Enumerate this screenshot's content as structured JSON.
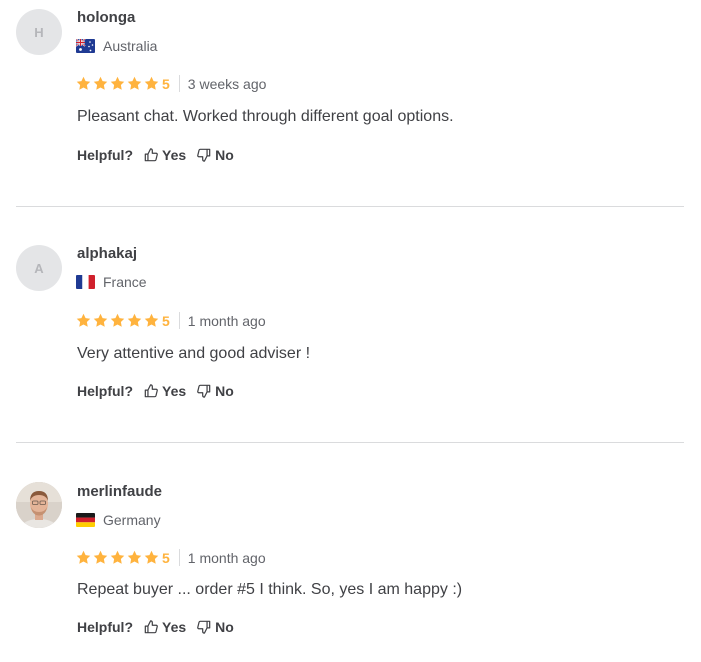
{
  "reviews": [
    {
      "avatar_initial": "H",
      "avatar_type": "initial",
      "username": "holonga",
      "country": "Australia",
      "flag_icon": "australia-flag-icon",
      "stars": 5,
      "rating": "5",
      "time": "3 weeks ago",
      "text": "Pleasant chat. Worked through different goal options.",
      "helpful_label": "Helpful?",
      "yes_label": "Yes",
      "no_label": "No"
    },
    {
      "avatar_initial": "A",
      "avatar_type": "initial",
      "username": "alphakaj",
      "country": "France",
      "flag_icon": "france-flag-icon",
      "stars": 5,
      "rating": "5",
      "time": "1 month ago",
      "text": "Very attentive and good adviser !",
      "helpful_label": "Helpful?",
      "yes_label": "Yes",
      "no_label": "No"
    },
    {
      "avatar_initial": "",
      "avatar_type": "photo",
      "username": "merlinfaude",
      "country": "Germany",
      "flag_icon": "germany-flag-icon",
      "stars": 5,
      "rating": "5",
      "time": "1 month ago",
      "text": "Repeat buyer ... order #5 I think. So, yes I am happy :)",
      "helpful_label": "Helpful?",
      "yes_label": "Yes",
      "no_label": "No"
    }
  ],
  "colors": {
    "star": "#ffb33e",
    "text": "#404145",
    "muted": "#62646a",
    "divider": "#dadbdd",
    "avatar_bg": "#e4e5e7"
  }
}
